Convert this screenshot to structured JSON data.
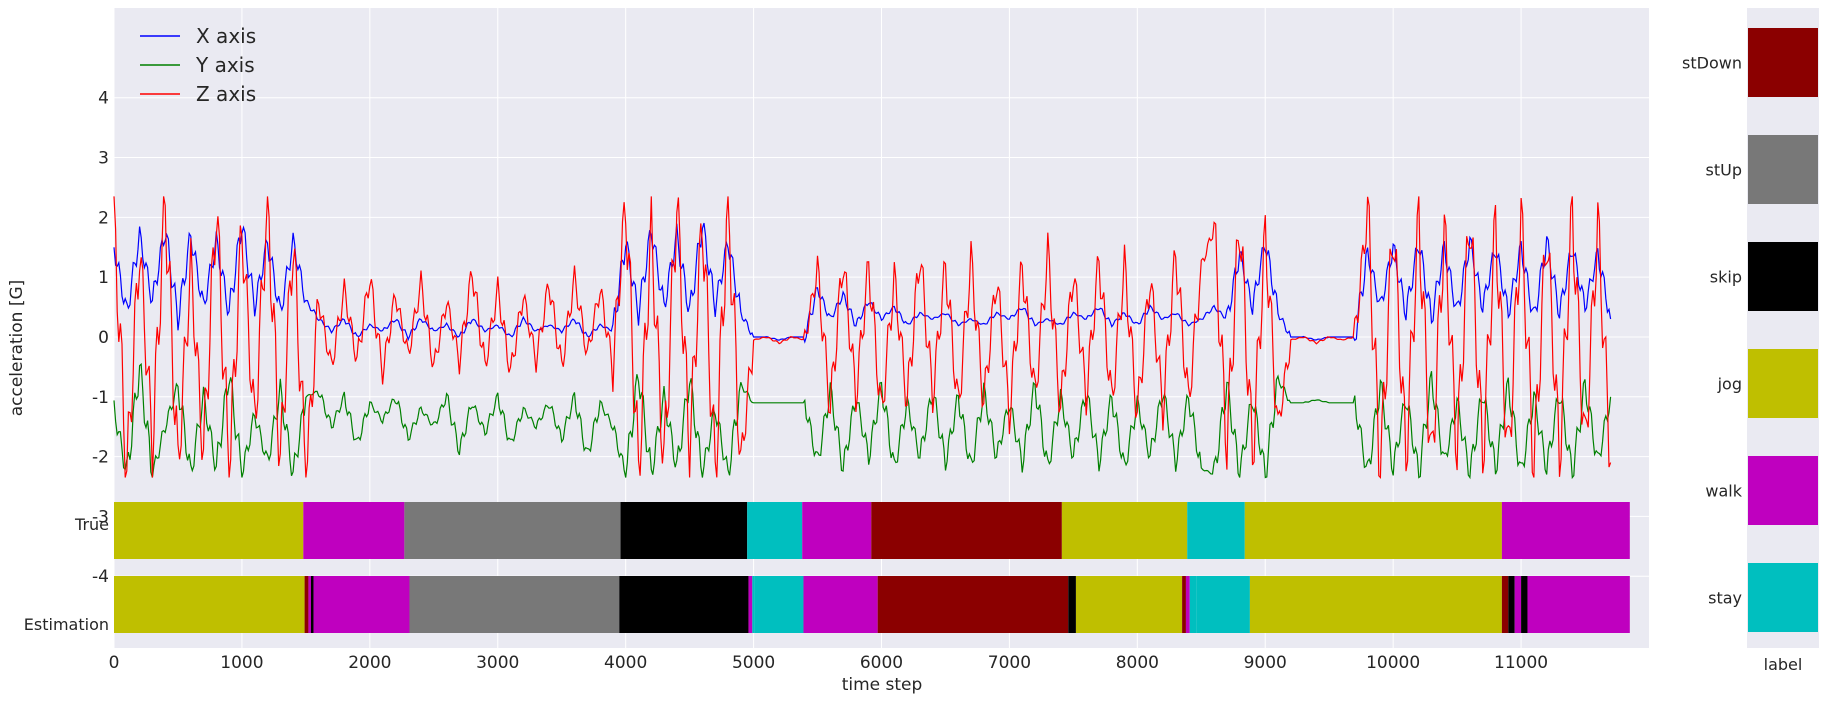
{
  "chart_data": [
    {
      "type": "line",
      "xlabel": "time step",
      "ylabel": "acceleration [G]",
      "xlim": [
        0,
        12000
      ],
      "ylim": [
        -5.2,
        5.5
      ],
      "x_ticks": [
        0,
        1000,
        2000,
        3000,
        4000,
        5000,
        6000,
        7000,
        8000,
        9000,
        10000,
        11000
      ],
      "y_ticks": [
        4,
        3,
        2,
        1,
        0,
        -1,
        -2,
        -3,
        -4
      ],
      "y_tick_labels": [
        "4",
        "3",
        "2",
        "1",
        "0",
        "-1",
        "-2",
        "-3",
        "-4"
      ],
      "grid": true,
      "legend_position": "top-left",
      "series": [
        {
          "name": "X axis",
          "color": "#0000ff",
          "sample_step": 100,
          "values": [
            1.5,
            0.4,
            1.7,
            0.6,
            1.8,
            0.3,
            1.7,
            0.5,
            1.6,
            0.4,
            1.9,
            0.5,
            1.6,
            0.4,
            1.6,
            0.6,
            0.3,
            0.1,
            0.3,
            0.0,
            0.2,
            0.1,
            0.3,
            0.0,
            0.3,
            0.1,
            0.2,
            0.0,
            0.3,
            0.1,
            0.2,
            0.0,
            0.3,
            0.1,
            0.2,
            0.1,
            0.3,
            0.0,
            0.2,
            0.1,
            1.6,
            0.4,
            1.8,
            0.5,
            1.7,
            0.4,
            1.9,
            0.5,
            1.6,
            0.4,
            0.0,
            0.0,
            -0.05,
            0.0,
            0.0,
            0.8,
            0.3,
            0.7,
            0.2,
            0.6,
            0.3,
            0.5,
            0.2,
            0.4,
            0.3,
            0.4,
            0.2,
            0.3,
            0.2,
            0.4,
            0.3,
            0.5,
            0.2,
            0.3,
            0.2,
            0.4,
            0.3,
            0.5,
            0.2,
            0.4,
            0.2,
            0.5,
            0.3,
            0.4,
            0.2,
            0.3,
            0.5,
            0.3,
            1.4,
            0.5,
            1.6,
            0.4,
            0.0,
            0.0,
            -0.05,
            0.0,
            0.0,
            0.0,
            1.4,
            0.5,
            1.5,
            0.4,
            1.6,
            0.3,
            1.5,
            0.4,
            1.6,
            0.5,
            1.5,
            0.4,
            1.5,
            0.3,
            1.6,
            0.4,
            1.5,
            0.5,
            1.4,
            0.3
          ]
        },
        {
          "name": "Y axis",
          "color": "#008000",
          "sample_step": 100,
          "values": [
            -1.2,
            -2.3,
            -0.5,
            -2.3,
            -1.5,
            -0.8,
            -2.3,
            -1.0,
            -2.2,
            -0.6,
            -2.3,
            -1.3,
            -2.1,
            -0.9,
            -2.3,
            -1.0,
            -0.9,
            -1.5,
            -1.0,
            -1.8,
            -1.1,
            -1.4,
            -1.0,
            -1.7,
            -1.2,
            -1.5,
            -1.0,
            -1.9,
            -1.1,
            -1.6,
            -1.0,
            -1.8,
            -1.2,
            -1.5,
            -1.1,
            -1.7,
            -1.0,
            -2.0,
            -1.1,
            -1.5,
            -2.3,
            -0.6,
            -2.3,
            -1.0,
            -2.2,
            -0.7,
            -2.3,
            -1.2,
            -2.3,
            -0.8,
            -1.1,
            -1.1,
            -1.1,
            -1.1,
            -1.1,
            -2.1,
            -0.9,
            -2.2,
            -1.0,
            -2.0,
            -0.8,
            -2.2,
            -1.1,
            -2.0,
            -0.9,
            -2.1,
            -1.0,
            -2.2,
            -0.9,
            -2.0,
            -1.1,
            -2.1,
            -0.8,
            -2.2,
            -1.0,
            -2.0,
            -0.9,
            -2.1,
            -1.0,
            -2.2,
            -1.1,
            -2.0,
            -0.9,
            -2.1,
            -1.0,
            -2.2,
            -2.3,
            -0.8,
            -2.3,
            -1.0,
            -2.3,
            -0.7,
            -1.1,
            -1.1,
            -1.05,
            -1.1,
            -1.1,
            -1.1,
            -2.3,
            -0.8,
            -2.2,
            -1.0,
            -2.3,
            -0.7,
            -2.1,
            -1.1,
            -2.3,
            -0.9,
            -2.2,
            -0.8,
            -2.3,
            -1.0,
            -2.2,
            -0.9,
            -2.3,
            -0.8,
            -2.1,
            -1.0
          ]
        },
        {
          "name": "Z axis",
          "color": "#ff0000",
          "sample_step": 100,
          "values": [
            2.0,
            -2.3,
            1.5,
            -1.8,
            2.3,
            -2.2,
            1.2,
            -2.0,
            2.2,
            -2.3,
            1.8,
            -1.5,
            2.3,
            -2.1,
            1.6,
            -2.3,
            0.6,
            -0.5,
            0.8,
            -0.4,
            1.0,
            -0.6,
            0.7,
            -0.3,
            0.9,
            -0.5,
            0.6,
            -0.4,
            1.1,
            -0.5,
            0.8,
            -0.6,
            0.7,
            -0.4,
            0.9,
            -0.5,
            1.0,
            -0.3,
            0.8,
            -0.5,
            2.3,
            -2.3,
            1.8,
            -2.2,
            2.3,
            -1.9,
            2.0,
            -2.3,
            2.3,
            -2.1,
            -0.05,
            0.0,
            -0.1,
            0.0,
            -0.05,
            1.1,
            -1.2,
            1.3,
            -1.0,
            1.2,
            -1.3,
            1.0,
            -1.1,
            1.4,
            -1.0,
            1.2,
            -1.2,
            1.3,
            -1.1,
            1.0,
            -1.3,
            1.2,
            -1.0,
            1.4,
            -1.2,
            1.1,
            -1.0,
            1.3,
            -1.1,
            1.2,
            -1.3,
            1.0,
            -1.2,
            1.4,
            -1.1,
            1.2,
            1.8,
            -1.8,
            2.0,
            -2.0,
            1.7,
            -1.5,
            -0.05,
            0.0,
            -0.1,
            0.0,
            -0.05,
            0.0,
            2.1,
            -2.3,
            1.9,
            -2.0,
            2.0,
            -2.2,
            1.8,
            -1.9,
            2.1,
            -2.0,
            1.9,
            -2.1,
            2.0,
            -2.2,
            1.8,
            -2.0,
            2.1,
            -1.9,
            1.9,
            -2.1
          ]
        }
      ]
    },
    {
      "type": "segments",
      "row_labels": [
        "True",
        "Estimation"
      ],
      "true_segments": [
        {
          "start": 0,
          "end": 1480,
          "label": "jog"
        },
        {
          "start": 1480,
          "end": 2270,
          "label": "walk"
        },
        {
          "start": 2270,
          "end": 3960,
          "label": "stUp"
        },
        {
          "start": 3960,
          "end": 4950,
          "label": "skip"
        },
        {
          "start": 4950,
          "end": 5380,
          "label": "stay"
        },
        {
          "start": 5380,
          "end": 5920,
          "label": "walk"
        },
        {
          "start": 5920,
          "end": 7410,
          "label": "stDown"
        },
        {
          "start": 7410,
          "end": 8390,
          "label": "jog"
        },
        {
          "start": 8390,
          "end": 8840,
          "label": "stay"
        },
        {
          "start": 8840,
          "end": 10850,
          "label": "jog"
        },
        {
          "start": 10850,
          "end": 11850,
          "label": "walk"
        }
      ],
      "estimation_segments": [
        {
          "start": 0,
          "end": 1490,
          "label": "jog"
        },
        {
          "start": 1490,
          "end": 1520,
          "label": "stDown"
        },
        {
          "start": 1520,
          "end": 1540,
          "label": "walk"
        },
        {
          "start": 1540,
          "end": 1560,
          "label": "skip"
        },
        {
          "start": 1560,
          "end": 2310,
          "label": "walk"
        },
        {
          "start": 2310,
          "end": 3950,
          "label": "stUp"
        },
        {
          "start": 3950,
          "end": 4960,
          "label": "skip"
        },
        {
          "start": 4960,
          "end": 4990,
          "label": "walk"
        },
        {
          "start": 4990,
          "end": 5010,
          "label": "stay"
        },
        {
          "start": 5010,
          "end": 5390,
          "label": "stay"
        },
        {
          "start": 5390,
          "end": 5970,
          "label": "walk"
        },
        {
          "start": 5970,
          "end": 7460,
          "label": "stDown"
        },
        {
          "start": 7460,
          "end": 7520,
          "label": "skip"
        },
        {
          "start": 7520,
          "end": 8350,
          "label": "jog"
        },
        {
          "start": 8350,
          "end": 8380,
          "label": "stDown"
        },
        {
          "start": 8380,
          "end": 8410,
          "label": "walk"
        },
        {
          "start": 8410,
          "end": 8460,
          "label": "stay"
        },
        {
          "start": 8460,
          "end": 8880,
          "label": "stay"
        },
        {
          "start": 8880,
          "end": 10850,
          "label": "jog"
        },
        {
          "start": 10850,
          "end": 10900,
          "label": "stDown"
        },
        {
          "start": 10900,
          "end": 10950,
          "label": "skip"
        },
        {
          "start": 10950,
          "end": 11000,
          "label": "walk"
        },
        {
          "start": 11000,
          "end": 11050,
          "label": "skip"
        },
        {
          "start": 11050,
          "end": 11850,
          "label": "walk"
        }
      ],
      "colorbar": {
        "title": "label",
        "items": [
          {
            "label": "stDown",
            "color": "#8b0000"
          },
          {
            "label": "stUp",
            "color": "#787878"
          },
          {
            "label": "skip",
            "color": "#000000"
          },
          {
            "label": "jog",
            "color": "#bfbf00"
          },
          {
            "label": "walk",
            "color": "#bf00bf"
          },
          {
            "label": "stay",
            "color": "#00bfbf"
          }
        ]
      }
    }
  ]
}
